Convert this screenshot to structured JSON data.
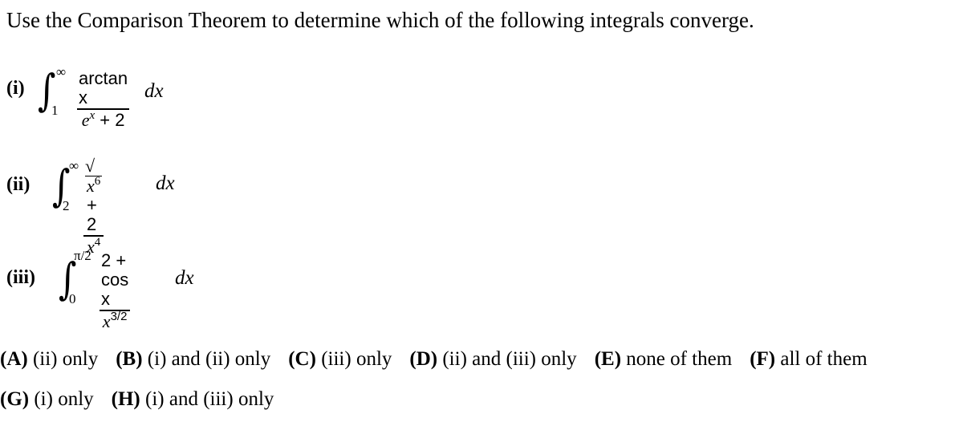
{
  "question": "Use the Comparison Theorem to determine which of the following integrals converge.",
  "integrals": [
    {
      "label": "(i)",
      "lower": "1",
      "upper": "∞",
      "numerator": "arctan x",
      "denominator_base": "e",
      "denominator_exp": "x",
      "denominator_rest": " + 2",
      "differential": "dx"
    },
    {
      "label": "(ii)",
      "lower": "2",
      "upper": "∞",
      "numerator_radicand_base": "x",
      "numerator_radicand_exp": "6",
      "numerator_radicand_rest": " + 2",
      "denominator_base": "x",
      "denominator_exp": "4",
      "differential": "dx"
    },
    {
      "label": "(iii)",
      "lower": "0",
      "upper": "π/2",
      "numerator": "2 + cos x",
      "denominator_base": "x",
      "denominator_exp": "3/2",
      "differential": "dx"
    }
  ],
  "choices": [
    {
      "letter": "(A)",
      "text": " (ii) only"
    },
    {
      "letter": "(B)",
      "text": " (i) and (ii) only"
    },
    {
      "letter": "(C)",
      "text": " (iii) only"
    },
    {
      "letter": "(D)",
      "text": " (ii) and (iii) only"
    },
    {
      "letter": "(E)",
      "text": " none of them"
    },
    {
      "letter": "(F)",
      "text": " all of them"
    },
    {
      "letter": "(G)",
      "text": " (i) only"
    },
    {
      "letter": "(H)",
      "text": " (i) and (iii) only"
    }
  ]
}
